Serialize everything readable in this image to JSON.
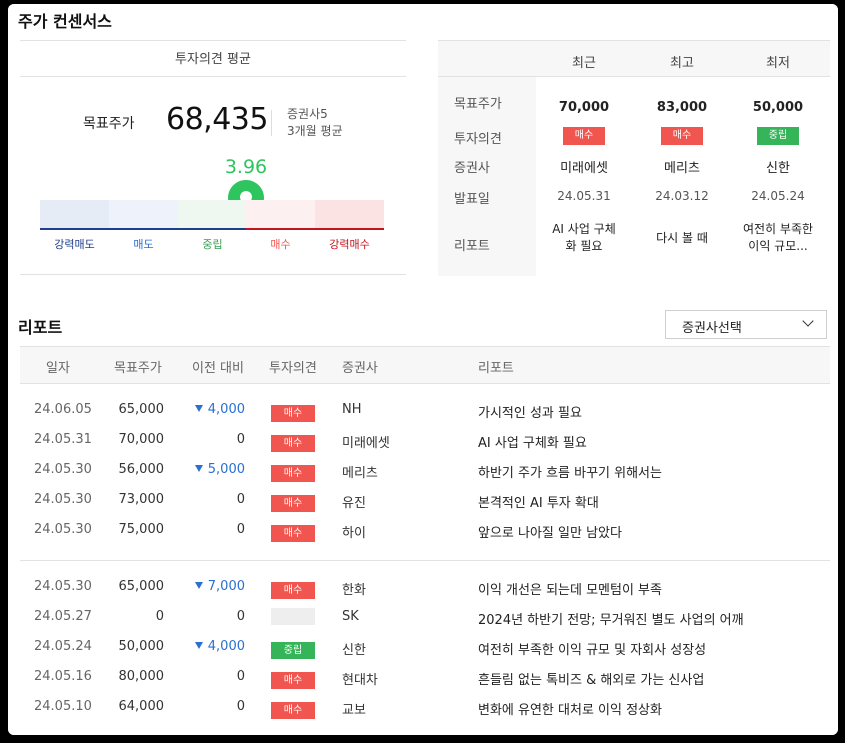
{
  "consensus": {
    "title": "주가 컨센서스",
    "avg_header": "투자의견 평균",
    "target_label": "목표주가",
    "target_value": "68,435",
    "brokers": "증권사5",
    "period": "3개월 평균",
    "score": "3.96",
    "score_fraction": 0.74,
    "gauge_labels": [
      "강력매도",
      "매도",
      "중립",
      "매수",
      "강력매수"
    ]
  },
  "recent": {
    "columns": [
      "최근",
      "최고",
      "최저"
    ],
    "row_labels": [
      "목표주가",
      "투자의견",
      "증권사",
      "발표일",
      "리포트"
    ],
    "cells": [
      {
        "price": "70,000",
        "opinion": "매수",
        "broker": "미래에셋",
        "date": "24.05.31",
        "report_l1": "AI 사업 구체",
        "report_l2": "화 필요"
      },
      {
        "price": "83,000",
        "opinion": "매수",
        "broker": "메리츠",
        "date": "24.03.12",
        "report_l1": "다시 볼 때",
        "report_l2": ""
      },
      {
        "price": "50,000",
        "opinion": "중립",
        "broker": "신한",
        "date": "24.05.24",
        "report_l1": "여전히 부족한",
        "report_l2": "이익 규모..."
      }
    ]
  },
  "report": {
    "title": "리포트",
    "select_label": "증권사선택",
    "headers": [
      "일자",
      "목표주가",
      "이전 대비",
      "투자의견",
      "증권사",
      "리포트"
    ],
    "rows": [
      {
        "date": "24.06.05",
        "price": "65,000",
        "change": "4,000",
        "down": true,
        "opinion": "매수",
        "broker": "NH",
        "title": "가시적인 성과 필요"
      },
      {
        "date": "24.05.31",
        "price": "70,000",
        "change": "0",
        "down": false,
        "opinion": "매수",
        "broker": "미래에셋",
        "title": "AI 사업 구체화 필요"
      },
      {
        "date": "24.05.30",
        "price": "56,000",
        "change": "5,000",
        "down": true,
        "opinion": "매수",
        "broker": "메리츠",
        "title": "하반기 주가 흐름 바꾸기 위해서는"
      },
      {
        "date": "24.05.30",
        "price": "73,000",
        "change": "0",
        "down": false,
        "opinion": "매수",
        "broker": "유진",
        "title": "본격적인 AI 투자 확대"
      },
      {
        "date": "24.05.30",
        "price": "75,000",
        "change": "0",
        "down": false,
        "opinion": "매수",
        "broker": "하이",
        "title": "앞으로 나아질 일만 남았다"
      },
      {
        "date": "24.05.30",
        "price": "65,000",
        "change": "7,000",
        "down": true,
        "opinion": "매수",
        "broker": "한화",
        "title": "이익 개선은 되는데 모멘텀이 부족"
      },
      {
        "date": "24.05.27",
        "price": "0",
        "change": "0",
        "down": false,
        "opinion": "",
        "broker": "SK",
        "title": "2024년 하반기 전망; 무거워진 별도 사업의 어깨"
      },
      {
        "date": "24.05.24",
        "price": "50,000",
        "change": "4,000",
        "down": true,
        "opinion": "중립",
        "broker": "신한",
        "title": "여전히 부족한 이익 규모 및 자회사 성장성"
      },
      {
        "date": "24.05.16",
        "price": "80,000",
        "change": "0",
        "down": false,
        "opinion": "매수",
        "broker": "현대차",
        "title": "흔들림 없는 톡비즈 & 해외로 가는 신사업"
      },
      {
        "date": "24.05.10",
        "price": "64,000",
        "change": "0",
        "down": false,
        "opinion": "매수",
        "broker": "교보",
        "title": "변화에 유연한 대처로 이익 정상화"
      }
    ]
  },
  "colors": {
    "buy": "#f0564f",
    "hold": "#36b45a",
    "down": "#2b6fd3",
    "score": "#2ec45e"
  }
}
